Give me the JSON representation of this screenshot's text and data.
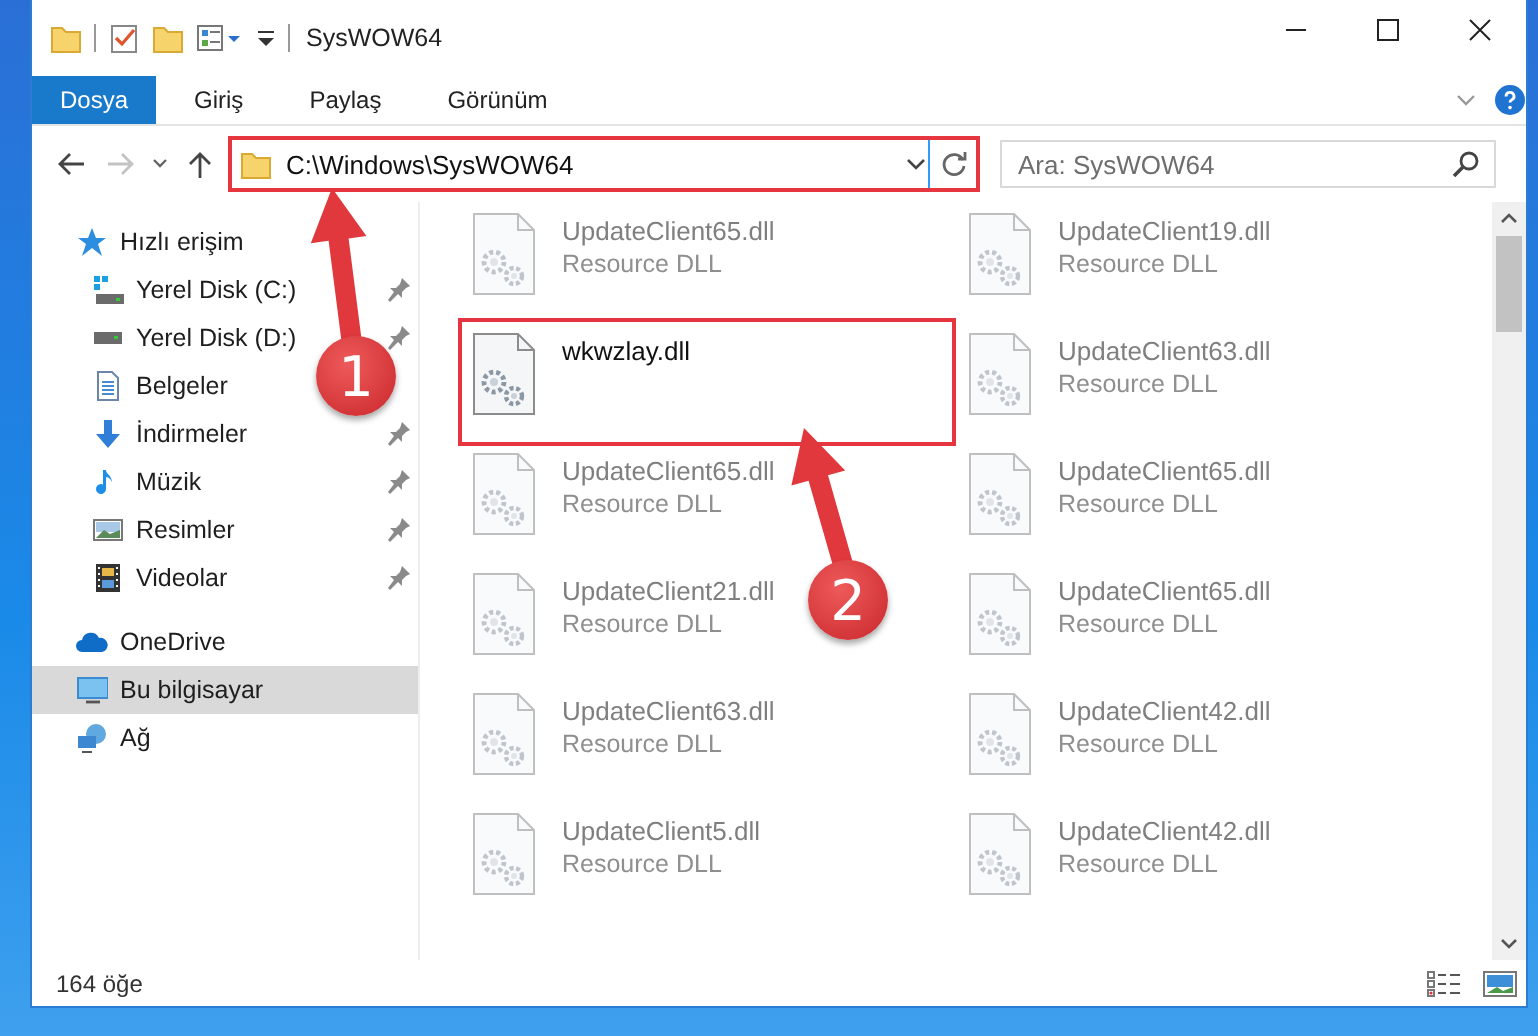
{
  "window": {
    "title": "SysWOW64"
  },
  "ribbon": {
    "tabs": [
      {
        "label": "Dosya",
        "selected": true
      },
      {
        "label": "Giriş",
        "selected": false
      },
      {
        "label": "Paylaş",
        "selected": false
      },
      {
        "label": "Görünüm",
        "selected": false
      }
    ]
  },
  "address": {
    "path": "C:\\Windows\\SysWOW64",
    "highlighted": true
  },
  "search": {
    "placeholder": "Ara: SysWOW64"
  },
  "sidebar": {
    "items": [
      {
        "label": "Hızlı erişim",
        "kind": "star",
        "selected": false,
        "children": [
          {
            "label": "Yerel Disk (C:)",
            "kind": "drive-win",
            "pinned": true,
            "selected": false
          },
          {
            "label": "Yerel Disk (D:)",
            "kind": "drive",
            "pinned": true,
            "selected": false
          },
          {
            "label": "Belgeler",
            "kind": "docs",
            "pinned": false,
            "selected": false
          },
          {
            "label": "İndirmeler",
            "kind": "download",
            "pinned": true,
            "selected": false
          },
          {
            "label": "Müzik",
            "kind": "music",
            "pinned": true,
            "selected": false
          },
          {
            "label": "Resimler",
            "kind": "pictures",
            "pinned": true,
            "selected": false
          },
          {
            "label": "Videolar",
            "kind": "video",
            "pinned": true,
            "selected": false
          }
        ]
      },
      {
        "label": "OneDrive",
        "kind": "cloud",
        "selected": false
      },
      {
        "label": "Bu bilgisayar",
        "kind": "computer",
        "selected": true
      },
      {
        "label": "Ağ",
        "kind": "network",
        "selected": false
      }
    ]
  },
  "files": [
    {
      "name": "UpdateClient65.dll",
      "type": "Resource DLL",
      "blurred": true,
      "highlighted": false
    },
    {
      "name": "UpdateClient19.dll",
      "type": "Resource DLL",
      "blurred": true,
      "highlighted": false
    },
    {
      "name": "wkwzlay.dll",
      "blurred": false,
      "highlighted": true
    },
    {
      "name": "UpdateClient63.dll",
      "type": "Resource DLL",
      "blurred": true,
      "highlighted": false
    },
    {
      "name": "UpdateClient65.dll",
      "type": "Resource DLL",
      "blurred": true,
      "highlighted": false
    },
    {
      "name": "UpdateClient65.dll",
      "type": "Resource DLL",
      "blurred": true,
      "highlighted": false
    },
    {
      "name": "UpdateClient21.dll",
      "type": "Resource DLL",
      "blurred": true,
      "highlighted": false
    },
    {
      "name": "UpdateClient65.dll",
      "type": "Resource DLL",
      "blurred": true,
      "highlighted": false
    },
    {
      "name": "UpdateClient63.dll",
      "type": "Resource DLL",
      "blurred": true,
      "highlighted": false
    },
    {
      "name": "UpdateClient42.dll",
      "type": "Resource DLL",
      "blurred": true,
      "highlighted": false
    },
    {
      "name": "UpdateClient5.dll",
      "type": "Resource DLL",
      "blurred": true,
      "highlighted": false
    },
    {
      "name": "UpdateClient42.dll",
      "type": "Resource DLL",
      "blurred": true,
      "highlighted": false
    }
  ],
  "status_bar": {
    "count": "164 öğe"
  },
  "callouts": [
    {
      "label": "1"
    },
    {
      "label": "2"
    }
  ]
}
